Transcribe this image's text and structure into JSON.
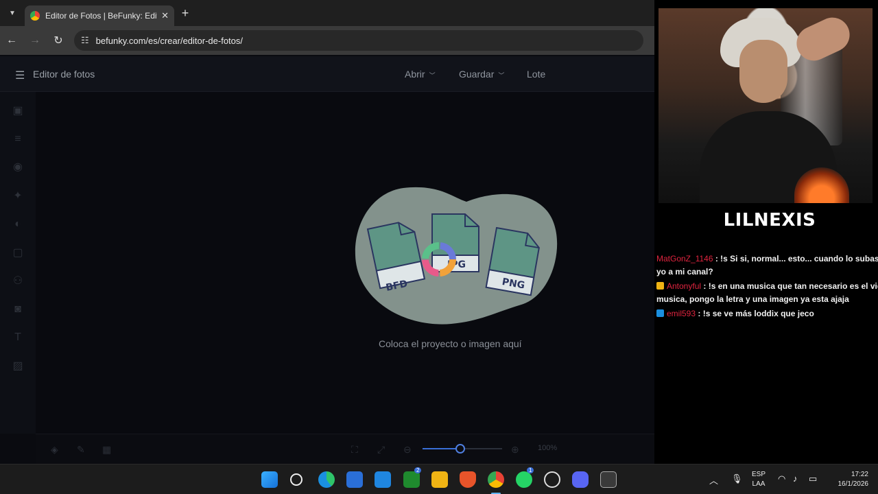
{
  "browser": {
    "tab_title": "Editor de Fotos | BeFunky: Edita",
    "tab_close": "✕",
    "new_tab": "+",
    "url": "befunky.com/es/crear/editor-de-fotos/"
  },
  "app": {
    "title": "Editor de fotos",
    "menu": {
      "open": "Abrir",
      "save": "Guardar",
      "batch": "Lote"
    },
    "dropzone": {
      "text": "Coloca el proyecto o imagen aquí",
      "formats": [
        "BFD",
        "JPG",
        "PNG"
      ]
    },
    "zoom": {
      "label": "100%",
      "level": 0.47
    }
  },
  "stream": {
    "channel_name": "LILNEXIS",
    "chat": [
      {
        "user": "MatGonZ_1146",
        "badge": "",
        "text": ": !s Si si, normal... esto... cuando lo subas",
        "continuation": "yo a mi canal?"
      },
      {
        "user": "Antonyful",
        "badge": "yellow",
        "text": ": !s en una musica que tan necesario es el vid",
        "continuation": "musica, pongo la letra y una imagen ya esta ajaja"
      },
      {
        "user": "emil593",
        "badge": "blue",
        "text": ": !s se ve más loddix que jeco",
        "continuation": ""
      }
    ]
  },
  "taskbar": {
    "lang_top": "ESP",
    "lang_bottom": "LAA",
    "time": "17:22",
    "date": "16/1/2026",
    "badges": {
      "xbox": "2",
      "whatsapp": "1"
    }
  },
  "colors": {
    "accent": "#3a6fd8",
    "chat_user": "#e0243f",
    "dropzone_blob": "#8a9a94",
    "file_teal": "#5e9585"
  }
}
